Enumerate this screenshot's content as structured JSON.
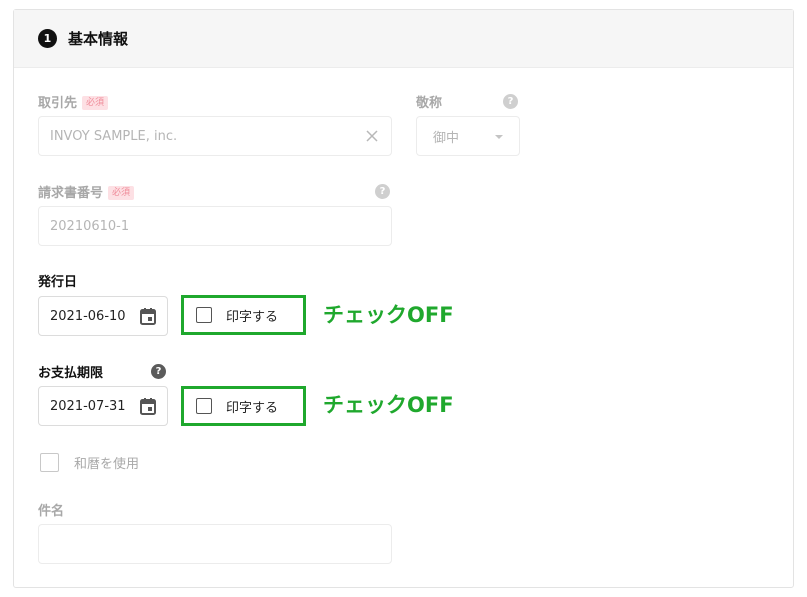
{
  "section": {
    "step": "1",
    "title": "基本情報"
  },
  "client": {
    "label": "取引先",
    "required": "必須",
    "value": "INVOY SAMPLE, inc."
  },
  "honorific": {
    "label": "敬称",
    "value": "御中"
  },
  "invoice_number": {
    "label": "請求書番号",
    "required": "必須",
    "value": "20210610-1"
  },
  "issue_date": {
    "label": "発行日",
    "value": "2021-06-10",
    "print_label": "印字する",
    "annotation": "チェックOFF"
  },
  "due_date": {
    "label": "お支払期限",
    "value": "2021-07-31",
    "print_label": "印字する",
    "annotation": "チェックOFF"
  },
  "japanese_era": {
    "label": "和暦を使用"
  },
  "subject": {
    "label": "件名",
    "value": ""
  },
  "colors": {
    "highlight": "#1fa82d",
    "required_bg": "#fde0e4",
    "required_text": "#ef8a98"
  },
  "icons": {
    "help": "help-icon",
    "clear": "close-icon",
    "dropdown": "chevron-down-icon",
    "calendar": "calendar-icon",
    "checkbox": "checkbox"
  }
}
